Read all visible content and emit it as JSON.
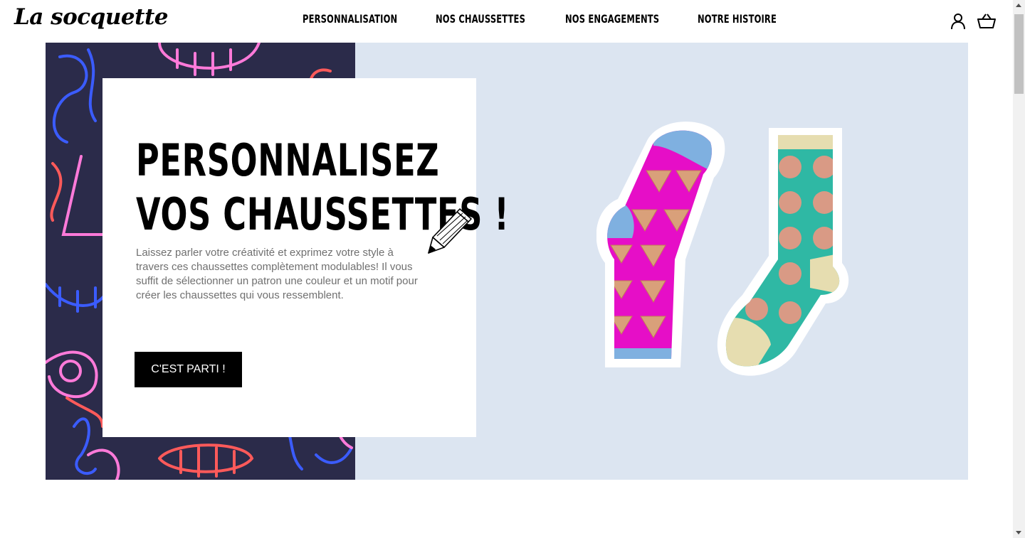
{
  "brand": {
    "logo_text": "La socquette"
  },
  "nav": {
    "items": [
      {
        "label": "PERSONNALISATION"
      },
      {
        "label": "NOS CHAUSSETTES"
      },
      {
        "label": "NOS ENGAGEMENTS"
      },
      {
        "label": "NOTRE HISTOIRE"
      }
    ]
  },
  "header_icons": {
    "account": "user-icon",
    "cart": "basket-icon"
  },
  "hero": {
    "title_line1": "PERSONNALISEZ",
    "title_line2": "VOS CHAUSSETTES !",
    "description": "Laissez parler votre créativité et exprimez votre style à travers ces chaussettes complètement modulables! Il vous suffit de sélectionner un patron une couleur et un motif pour créer les chaussettes qui vous ressemblent.",
    "cta_label": "C'EST PARTI !"
  },
  "colors": {
    "pattern_bg": "#2b2b4a",
    "hero_bg": "#dce5f1",
    "accent_pink": "#e60ec7",
    "accent_teal": "#2fb8a4",
    "button_bg": "#000000"
  }
}
